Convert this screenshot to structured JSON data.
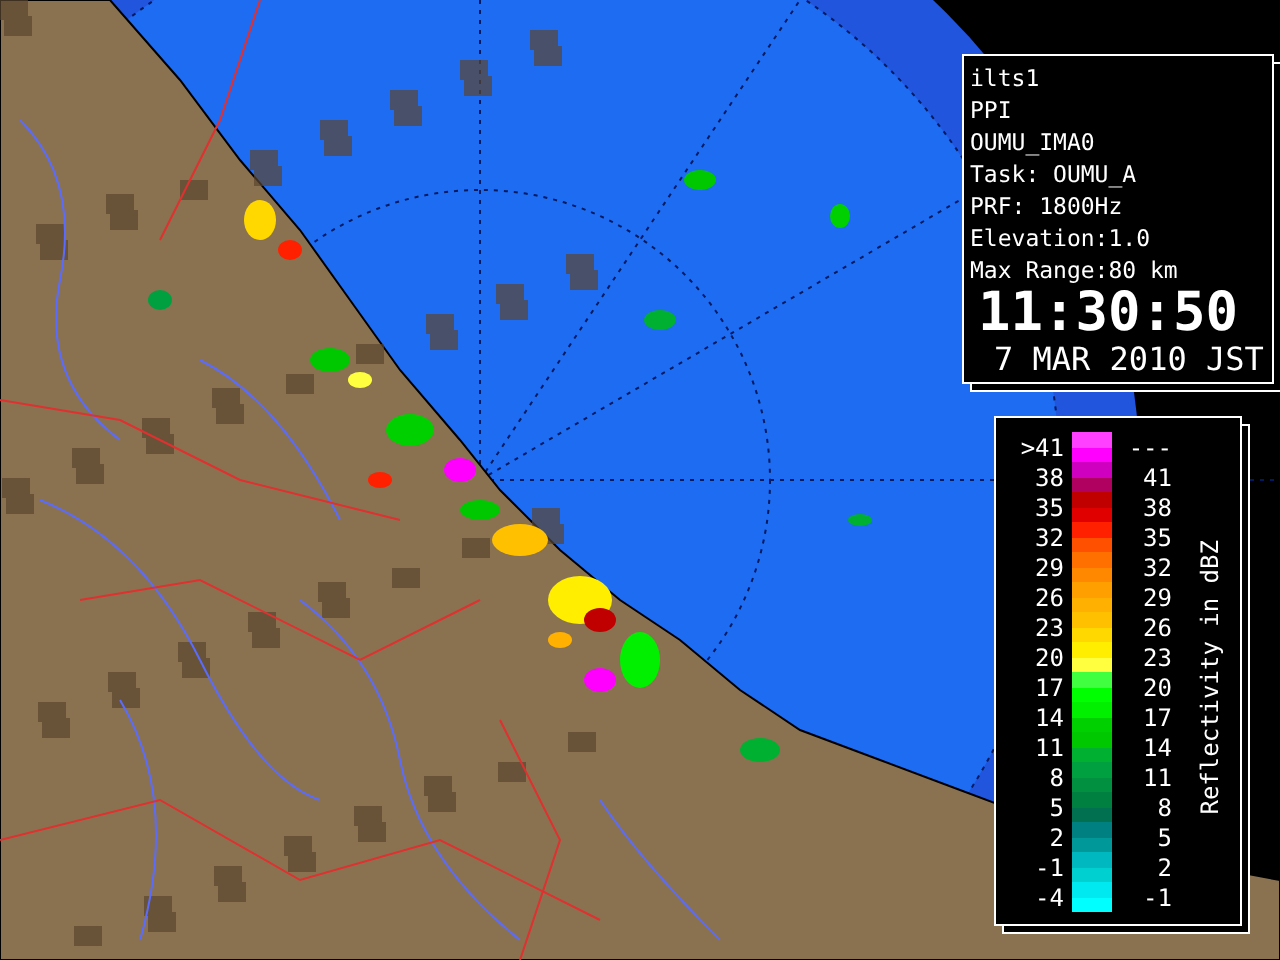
{
  "info_panel": {
    "lines": [
      "ilts1",
      "PPI",
      "OUMU_IMA0",
      "Task: OUMU_A",
      "PRF: 1800Hz",
      "Elevation:1.0",
      "Max Range:80 km"
    ],
    "time": "11:30:50",
    "date": "7 MAR 2010 JST"
  },
  "legend": {
    "title": "Reflectivity in dBZ",
    "rows": [
      {
        "low": ">41",
        "high": "---",
        "stripes": [
          {
            "color": "#ff40ff"
          },
          {
            "color": "#ff00ff"
          }
        ]
      },
      {
        "low": "38",
        "high": "41",
        "stripes": [
          {
            "color": "#d000c0"
          },
          {
            "color": "#b00060"
          }
        ]
      },
      {
        "low": "35",
        "high": "38",
        "stripes": [
          {
            "color": "#c00000"
          },
          {
            "color": "#e00000"
          }
        ]
      },
      {
        "low": "32",
        "high": "35",
        "stripes": [
          {
            "color": "#ff2000"
          },
          {
            "color": "#ff5000"
          }
        ]
      },
      {
        "low": "29",
        "high": "32",
        "stripes": [
          {
            "color": "#ff7000"
          },
          {
            "color": "#ff8800"
          }
        ]
      },
      {
        "low": "26",
        "high": "29",
        "stripes": [
          {
            "color": "#ffa000"
          },
          {
            "color": "#ffb000"
          }
        ]
      },
      {
        "low": "23",
        "high": "26",
        "stripes": [
          {
            "color": "#ffc000"
          },
          {
            "color": "#ffd800"
          }
        ]
      },
      {
        "low": "20",
        "high": "23",
        "stripes": [
          {
            "color": "#ffee00"
          },
          {
            "color": "#ffff40"
          }
        ]
      },
      {
        "low": "17",
        "high": "20",
        "stripes": [
          {
            "color": "#40ff40"
          },
          {
            "color": "#00ff00"
          }
        ]
      },
      {
        "low": "14",
        "high": "17",
        "stripes": [
          {
            "color": "#00f000"
          },
          {
            "color": "#00d000"
          }
        ]
      },
      {
        "low": "11",
        "high": "14",
        "stripes": [
          {
            "color": "#00c800"
          },
          {
            "color": "#00b030"
          }
        ]
      },
      {
        "low": "8",
        "high": "11",
        "stripes": [
          {
            "color": "#00a040"
          },
          {
            "color": "#009040"
          }
        ]
      },
      {
        "low": "5",
        "high": "8",
        "stripes": [
          {
            "color": "#008040"
          },
          {
            "color": "#007050"
          }
        ]
      },
      {
        "low": "2",
        "high": "5",
        "stripes": [
          {
            "color": "#008080"
          },
          {
            "color": "#009898"
          }
        ]
      },
      {
        "low": "-1",
        "high": "2",
        "stripes": [
          {
            "color": "#00b8c0"
          },
          {
            "color": "#00d0d0"
          }
        ]
      },
      {
        "low": "-4",
        "high": "-1",
        "stripes": [
          {
            "color": "#00e8f0"
          },
          {
            "color": "#00ffff"
          }
        ]
      }
    ]
  }
}
